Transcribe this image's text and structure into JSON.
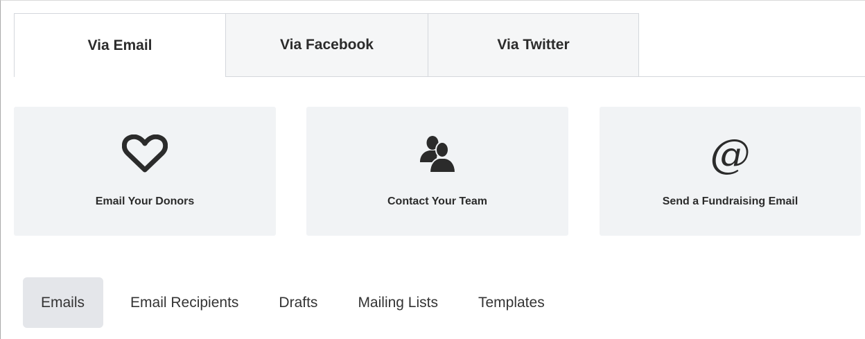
{
  "tabs": [
    {
      "label": "Via Email",
      "active": true
    },
    {
      "label": "Via Facebook",
      "active": false
    },
    {
      "label": "Via Twitter",
      "active": false
    }
  ],
  "cards": [
    {
      "label": "Email Your Donors",
      "icon": "heart-icon"
    },
    {
      "label": "Contact Your Team",
      "icon": "team-icon"
    },
    {
      "label": "Send a Fundraising Email",
      "icon": "at-sign-icon",
      "glyph": "@"
    }
  ],
  "subnav": [
    {
      "label": "Emails",
      "active": true
    },
    {
      "label": "Email Recipients",
      "active": false
    },
    {
      "label": "Drafts",
      "active": false
    },
    {
      "label": "Mailing Lists",
      "active": false
    },
    {
      "label": "Templates",
      "active": false
    }
  ],
  "colors": {
    "text": "#2b2b2b",
    "card_bg": "#f1f3f5",
    "active_pill_bg": "#e4e6ea",
    "inactive_tab_bg": "#f5f6f7",
    "border": "#d4d7dc"
  }
}
